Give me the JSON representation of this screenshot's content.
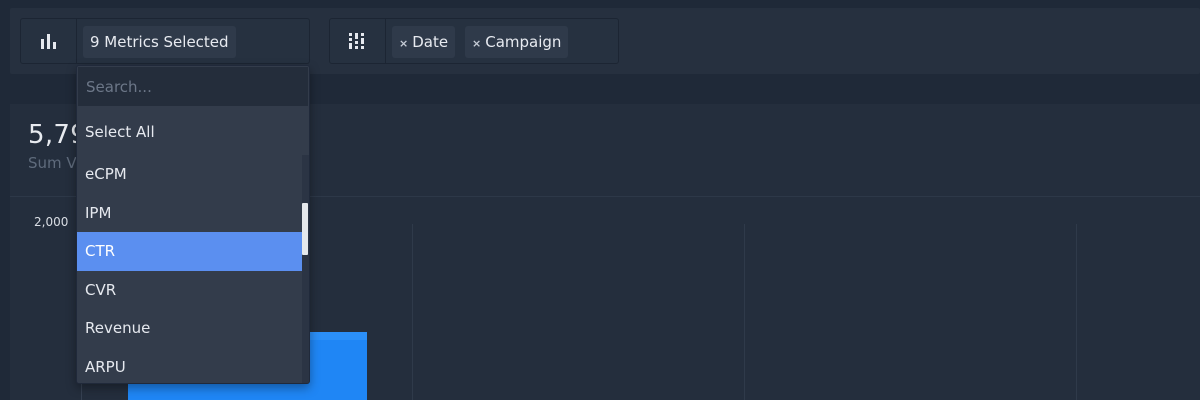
{
  "toolbar": {
    "metrics_icon": "bar-chart-icon",
    "metrics_chip": "9 Metrics Selected",
    "dimensions_icon": "columns-icon",
    "dimension_chips": [
      {
        "remove_icon": "×",
        "label": "Date"
      },
      {
        "remove_icon": "×",
        "label": "Campaign"
      }
    ]
  },
  "kpi": {
    "value": "5,79",
    "label": "Sum V"
  },
  "chart": {
    "y_tick": "2,000",
    "bar_color": "#1f86f5"
  },
  "dropdown": {
    "search_placeholder": "Search...",
    "select_all": "Select All",
    "items": [
      {
        "label": "eCPM"
      },
      {
        "label": "IPM"
      },
      {
        "label": "CTR"
      },
      {
        "label": "CVR"
      },
      {
        "label": "Revenue"
      },
      {
        "label": "ARPU"
      }
    ],
    "active_item": "CTR",
    "active_color": "#5b8ff0"
  }
}
